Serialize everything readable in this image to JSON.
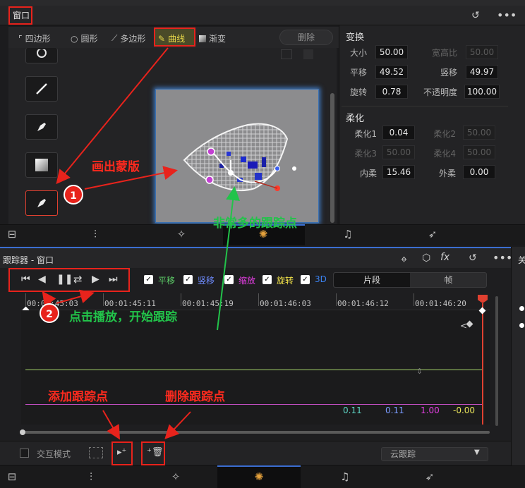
{
  "window": {
    "title": "窗口"
  },
  "shape_toolbar": {
    "tools": [
      {
        "label": "四边形",
        "icon": "rectangle-icon"
      },
      {
        "label": "圆形",
        "icon": "circle-icon"
      },
      {
        "label": "多边形",
        "icon": "polygon-icon"
      },
      {
        "label": "曲线",
        "icon": "bezier-pen-icon",
        "active": true
      },
      {
        "label": "渐变",
        "icon": "gradient-icon"
      }
    ],
    "delete_label": "删除"
  },
  "shape_list": {
    "items": [
      "circle-shape-icon",
      "line-shape-icon",
      "pen-shape-icon",
      "gradient-shape-icon",
      "pen-shape-icon"
    ]
  },
  "transform": {
    "title": "变换",
    "fields": [
      {
        "label": "大小",
        "value": "50.00",
        "enabled": true
      },
      {
        "label": "宽高比",
        "value": "50.00",
        "enabled": false
      },
      {
        "label": "平移",
        "value": "49.52",
        "enabled": true
      },
      {
        "label": "竖移",
        "value": "49.97",
        "enabled": true
      },
      {
        "label": "旋转",
        "value": "0.78",
        "enabled": true
      },
      {
        "label": "不透明度",
        "value": "100.00",
        "enabled": true
      }
    ]
  },
  "softness": {
    "title": "柔化",
    "fields": [
      {
        "label": "柔化1",
        "value": "0.04",
        "enabled": true
      },
      {
        "label": "柔化2",
        "value": "50.00",
        "enabled": false
      },
      {
        "label": "柔化3",
        "value": "50.00",
        "enabled": false
      },
      {
        "label": "柔化4",
        "value": "50.00",
        "enabled": false
      },
      {
        "label": "内柔",
        "value": "15.46",
        "enabled": true
      },
      {
        "label": "外柔",
        "value": "0.00",
        "enabled": true
      }
    ]
  },
  "tracker": {
    "title": "跟踪器 - 窗口",
    "checkboxes": [
      {
        "label": "平移",
        "color": "#5fd36a"
      },
      {
        "label": "竖移",
        "color": "#6f8cff"
      },
      {
        "label": "缩放",
        "color": "#e23ee0"
      },
      {
        "label": "旋转",
        "color": "#f2e34a"
      },
      {
        "label": "3D",
        "color": "#3b82f0"
      }
    ],
    "segment": {
      "clip_label": "片段",
      "frame_label": "帧"
    },
    "timecodes": [
      "00:01:45:03",
      "00:01:45:11",
      "00:01:45:19",
      "00:01:46:03",
      "00:01:46:12",
      "00:01:46:20"
    ],
    "values": [
      {
        "text": "0.11",
        "color": "#5fd6c6"
      },
      {
        "text": "0.11",
        "color": "#7a9bff"
      },
      {
        "text": "1.00",
        "color": "#e23ee0"
      },
      {
        "text": "-0.00",
        "color": "#e8e35a"
      }
    ],
    "interactive_mode_label": "交互模式",
    "dropdown_value": "云跟踪"
  },
  "right_edge_label": "关",
  "annotations": {
    "draw_mask": "画出蒙版",
    "many_points": "非常多的跟踪点",
    "click_play": "点击播放，开始跟踪",
    "add_point": "添加跟踪点",
    "delete_point": "删除跟踪点",
    "badge1": "1",
    "badge2": "2"
  },
  "colors": {
    "accent_blue": "#3b6ed1",
    "annotation_red": "#e8231c",
    "annotation_green": "#22c34a",
    "playhead": "#e04030"
  }
}
